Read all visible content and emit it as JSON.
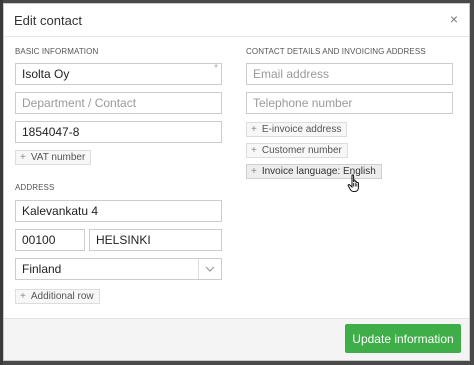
{
  "dialog": {
    "title": "Edit contact",
    "close_icon": "×"
  },
  "basic_info": {
    "label": "BASIC INFORMATION",
    "name": "Isolta Oy",
    "name_required_mark": "*",
    "department_placeholder": "Department / Contact",
    "business_id": "1854047-8",
    "vat_chip": "VAT number"
  },
  "address": {
    "label": "ADDRESS",
    "street": "Kalevankatu 4",
    "postcode": "00100",
    "city": "HELSINKI",
    "country": "Finland",
    "additional_row_chip": "Additional row"
  },
  "contact_details": {
    "label": "CONTACT DETAILS AND INVOICING ADDRESS",
    "email_placeholder": "Email address",
    "phone_placeholder": "Telephone number",
    "einvoice_chip": "E-invoice address",
    "customer_number_chip": "Customer number",
    "invoice_language_chip": "Invoice language: English"
  },
  "footer": {
    "update_button": "Update information"
  },
  "icons": {
    "plus": "plus-icon",
    "chevron": "chevron-down-icon",
    "close": "close-icon",
    "cursor": "hand-pointer-icon"
  },
  "colors": {
    "primary_button": "#3fae49",
    "backdrop": "#4a4a4a"
  }
}
